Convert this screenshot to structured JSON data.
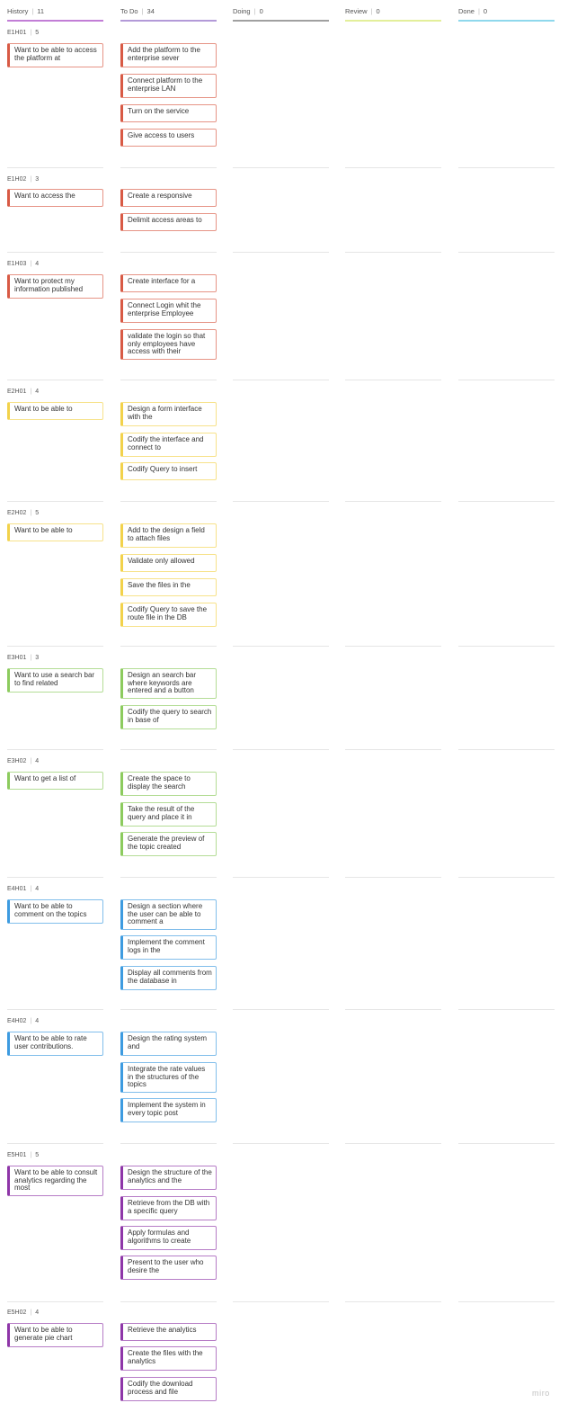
{
  "columns": [
    {
      "name": "History",
      "count": "11",
      "color": "#c27ed6"
    },
    {
      "name": "To Do",
      "count": "34",
      "color": "#b39ad8"
    },
    {
      "name": "Doing",
      "count": "0",
      "color": "#a0a0a0"
    },
    {
      "name": "Review",
      "count": "0",
      "color": "#e3ef9a"
    },
    {
      "name": "Done",
      "count": "0",
      "color": "#8fd8ec"
    }
  ],
  "swimlanes": [
    {
      "id": "E1H01",
      "count": "5",
      "color": "#d85a45",
      "history": [
        "Want to be able to access the platform at"
      ],
      "todo": [
        "Add the platform to the enterprise sever",
        "Connect platform to the enterprise  LAN",
        "Turn on the service",
        "Give access to users"
      ]
    },
    {
      "id": "E1H02",
      "count": "3",
      "color": "#d85a45",
      "history": [
        "Want to access the"
      ],
      "todo": [
        "Create a responsive",
        "Delimit access areas to"
      ]
    },
    {
      "id": "E1H03",
      "count": "4",
      "color": "#d85a45",
      "history": [
        "Want to protect my information published"
      ],
      "todo": [
        "Create interface for a",
        "Connect Login whit the enterprise Employee",
        "validate the login so that only employees have access with their"
      ]
    },
    {
      "id": "E2H01",
      "count": "4",
      "color": "#f2d24b",
      "history": [
        "Want to be able to"
      ],
      "todo": [
        "Design a form interface with the",
        "Codify the interface and connect to",
        "Codify Query to insert"
      ]
    },
    {
      "id": "E2H02",
      "count": "5",
      "color": "#f2d24b",
      "history": [
        "Want to be able to"
      ],
      "todo": [
        "Add to the design a field to attach files",
        "Validate only allowed",
        "Save the files in the",
        "Codify Query to save the route file in the DB"
      ]
    },
    {
      "id": "E3H01",
      "count": "3",
      "color": "#8ccb5e",
      "history": [
        "Want to use a search bar to find related"
      ],
      "todo": [
        "Design an search bar where keywords are entered and a button",
        "Codify the query to search in base of"
      ]
    },
    {
      "id": "E3H02",
      "count": "4",
      "color": "#8ccb5e",
      "history": [
        "Want to get a list of"
      ],
      "todo": [
        "Create the space to display the search",
        "Take the result of the query and place it in",
        "Generate the preview of the topic created"
      ]
    },
    {
      "id": "E4H01",
      "count": "4",
      "color": "#3d9be0",
      "history": [
        "Want to be able to comment on the topics"
      ],
      "todo": [
        "Design a section where the user can be able to comment a",
        "Implement the comment logs in the",
        "Display all comments from the database in"
      ]
    },
    {
      "id": "E4H02",
      "count": "4",
      "color": "#3d9be0",
      "history": [
        "Want to be able to rate user contributions."
      ],
      "todo": [
        "Design the rating system and",
        "Integrate the rate values in the structures of the topics",
        "Implement the system in every topic post"
      ]
    },
    {
      "id": "E5H01",
      "count": "5",
      "color": "#8e36a8",
      "history": [
        "Want to be able to consult analytics regarding the most"
      ],
      "todo": [
        "Design the structure of the analytics and the",
        "Retrieve from the DB with a specific query",
        "Apply formulas and algorithms to create",
        "Present to the user who desire the"
      ]
    },
    {
      "id": "E5H02",
      "count": "4",
      "color": "#8e36a8",
      "history": [
        "Want to be able to generate pie chart"
      ],
      "todo": [
        "Retrieve the analytics",
        "Create the files with the analytics",
        "Codify the download process and file"
      ]
    }
  ],
  "watermark": "miro"
}
